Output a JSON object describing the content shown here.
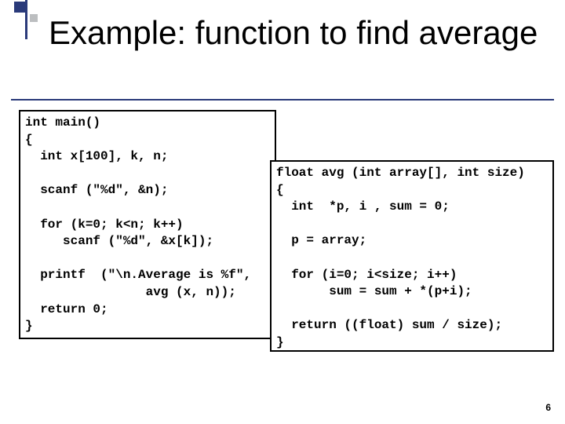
{
  "slide": {
    "title": "Example: function to find average",
    "page_number": "6"
  },
  "code": {
    "left": "int main()\n{\n  int x[100], k, n;\n\n  scanf (\"%d\", &n);\n\n  for (k=0; k<n; k++)\n     scanf (\"%d\", &x[k]);\n\n  printf  (\"\\n.Average is %f\",\n                avg (x, n));\n  return 0;\n}",
    "right": "float avg (int array[], int size)\n{\n  int  *p, i , sum = 0;\n\n  p = array;\n\n  for (i=0; i<size; i++)\n       sum = sum + *(p+i);\n\n  return ((float) sum / size);\n}"
  }
}
